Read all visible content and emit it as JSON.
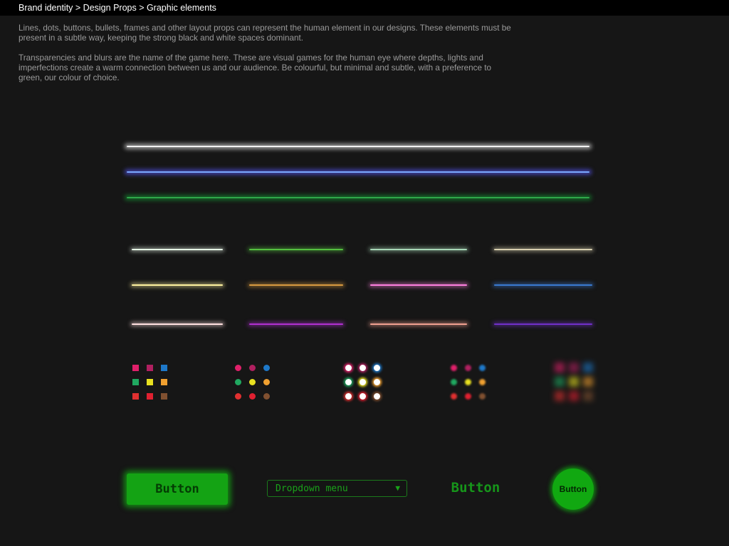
{
  "header": {
    "breadcrumb": "Brand identity > Design Props > Graphic elements"
  },
  "intro": {
    "paragraph1": "Lines, dots, buttons, bullets, frames and other layout props can represent the human element in our designs. These elements must be present in a subtle way, keeping the strong black and white spaces dominant.",
    "paragraph2": "Transparencies and blurs are the name of the game here. These are visual games for the human eye where depths, lights and imperfections create a warm connection between us and our audience. Be colourful, but minimal and subtle,  with a preference to green, our colour of choice."
  },
  "colors": {
    "background": "#161616",
    "topbar": "#000000",
    "brand_green": "#14a314",
    "line_white": "#f2f2f2",
    "line_blue": "#7aa8ff",
    "line_green": "#2fa84a"
  },
  "short_line_colors": {
    "row1": [
      "#e6f5e6",
      "#55c040",
      "#a8d8b8",
      "#d8d0b0"
    ],
    "row2": [
      "#fff2a0",
      "#d89a40",
      "#ff80e0",
      "#3a7ad0"
    ],
    "row3": [
      "#ffe0e0",
      "#b030d0",
      "#f0a090",
      "#7030c8"
    ]
  },
  "swatch_colors": [
    [
      "#e0206a",
      "#b02060",
      "#1e78c8"
    ],
    [
      "#20a860",
      "#e8e020",
      "#f0a030"
    ],
    [
      "#e03030",
      "#e02030",
      "#805030"
    ]
  ],
  "buttons": {
    "glow_button_label": "Button",
    "dropdown_label": "Dropdown menu",
    "dropdown_arrow": "▼",
    "text_button_label": "Button",
    "circle_button_label": "Button"
  }
}
